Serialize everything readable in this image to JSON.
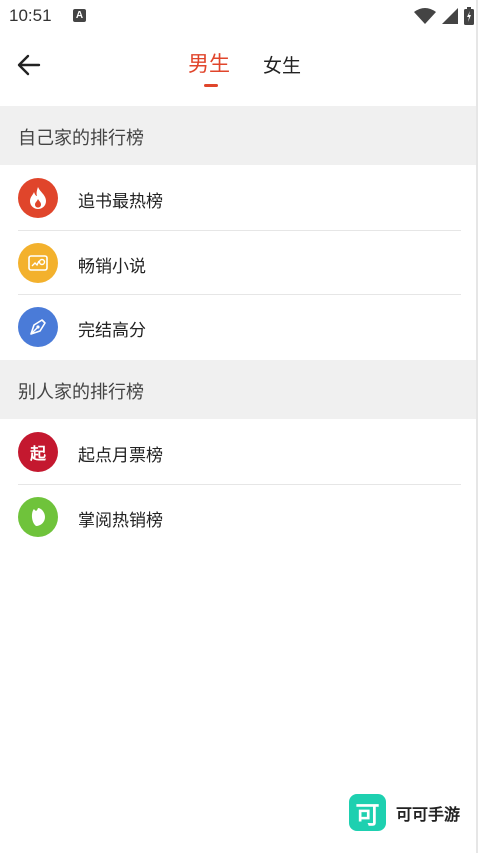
{
  "status": {
    "time": "10:51",
    "notif": "A"
  },
  "header": {
    "tab_male": "男生",
    "tab_female": "女生"
  },
  "sections": [
    {
      "title": "自己家的排行榜"
    },
    {
      "title": "别人家的排行榜"
    }
  ],
  "items": [
    {
      "label": "追书最热榜",
      "icon": "fire-icon",
      "color": "#e0452b"
    },
    {
      "label": "畅销小说",
      "icon": "sales-chart-icon",
      "color": "#f3b12d"
    },
    {
      "label": "完结高分",
      "icon": "pen-nib-icon",
      "color": "#4a7bd8"
    },
    {
      "label": "起点月票榜",
      "icon": "qidian-icon",
      "icon_text": "起",
      "color": "#c4182f"
    },
    {
      "label": "掌阅热销榜",
      "icon": "zhangyue-leaf-icon",
      "color": "#6fc33b"
    }
  ],
  "brand": {
    "logo_text": "可",
    "name": "可可手游"
  }
}
